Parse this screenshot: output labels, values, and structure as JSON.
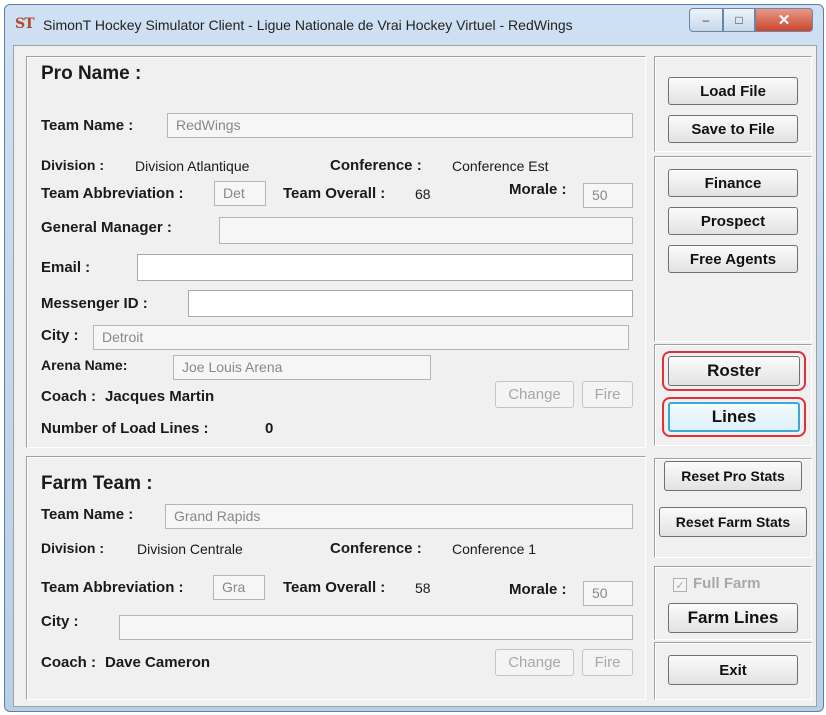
{
  "window": {
    "icon_text": "ST",
    "title": "SimonT Hockey Simulator Client - Ligue Nationale de Vrai Hockey Virtuel - RedWings",
    "min_glyph": "–",
    "max_glyph": "□",
    "close_glyph": "✕"
  },
  "pro": {
    "header": "Pro Name :",
    "team_name_label": "Team Name :",
    "team_name_value": "RedWings",
    "division_label": "Division :",
    "division_value": "Division Atlantique",
    "conference_label": "Conference :",
    "conference_value": "Conference Est",
    "abbrev_label": "Team Abbreviation :",
    "abbrev_value": "Det",
    "overall_label": "Team Overall :",
    "overall_value": "68",
    "morale_label": "Morale :",
    "morale_value": "50",
    "gm_label": "General Manager :",
    "gm_value": "",
    "email_label": "Email :",
    "email_value": "",
    "messenger_label": "Messenger ID :",
    "messenger_value": "",
    "city_label": "City :",
    "city_value": "Detroit",
    "arena_label": "Arena Name:",
    "arena_value": "Joe Louis Arena",
    "coach_label": "Coach :",
    "coach_value": "Jacques Martin",
    "change_label": "Change",
    "fire_label": "Fire",
    "load_lines_label": "Number of Load Lines :",
    "load_lines_value": "0"
  },
  "farm": {
    "header": "Farm Team :",
    "team_name_label": "Team Name :",
    "team_name_value": "Grand Rapids",
    "division_label": "Division :",
    "division_value": "Division Centrale",
    "conference_label": "Conference :",
    "conference_value": "Conference 1",
    "abbrev_label": "Team Abbreviation :",
    "abbrev_value": "Gra",
    "overall_label": "Team Overall :",
    "overall_value": "58",
    "morale_label": "Morale :",
    "morale_value": "50",
    "city_label": "City :",
    "city_value": "",
    "coach_label": "Coach :",
    "coach_value": "Dave Cameron",
    "change_label": "Change",
    "fire_label": "Fire"
  },
  "sidebar": {
    "load_file": "Load File",
    "save_to_file": "Save to File",
    "finance": "Finance",
    "prospect": "Prospect",
    "free_agents": "Free Agents",
    "roster": "Roster",
    "lines": "Lines",
    "reset_pro_stats": "Reset Pro Stats",
    "reset_farm_stats": "Reset Farm Stats",
    "full_farm_check": "✓",
    "full_farm": "Full Farm",
    "farm_lines": "Farm Lines",
    "exit": "Exit"
  },
  "colors": {
    "highlight": "#e0303a",
    "focus_border": "#3ea7d9"
  }
}
